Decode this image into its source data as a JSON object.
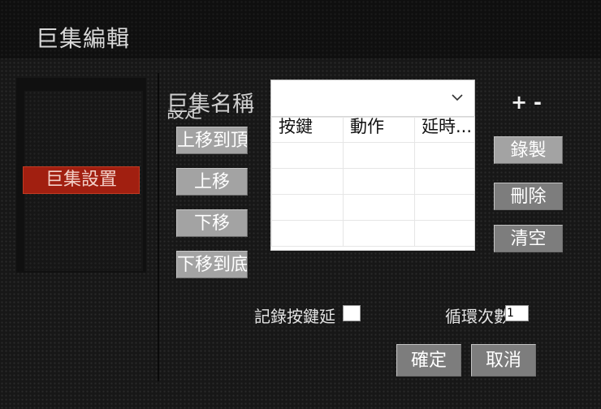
{
  "window": {
    "title": "巨集編輯"
  },
  "sidebar": {
    "items": [
      {
        "label": "巨集設置",
        "selected": true
      }
    ]
  },
  "macro": {
    "name_label": "巨集名稱",
    "name_label_overflow": "設定",
    "name_value": "",
    "add_symbol": "+",
    "remove_symbol": "-"
  },
  "move_buttons": {
    "to_top": "上移到頂",
    "up": "上移",
    "down": "下移",
    "to_bottom": "下移到底"
  },
  "table": {
    "columns": [
      "按鍵",
      "動作",
      "延時..."
    ],
    "rows": [
      [
        "",
        "",
        ""
      ],
      [
        "",
        "",
        ""
      ],
      [
        "",
        "",
        ""
      ],
      [
        "",
        "",
        ""
      ]
    ]
  },
  "actions": {
    "record": "錄製",
    "delete": "刪除",
    "clear": "清空"
  },
  "options": {
    "record_interval_label": "記錄按鍵延",
    "record_interval_value": "",
    "loop_count_label": "循環次數",
    "loop_count_value": "1"
  },
  "footer": {
    "ok": "確定",
    "cancel": "取消"
  },
  "icons": {
    "dropdown": "chevron-down-icon"
  },
  "colors": {
    "accent": "#a11f10",
    "background": "#171717",
    "button": "#a3a3a3"
  }
}
